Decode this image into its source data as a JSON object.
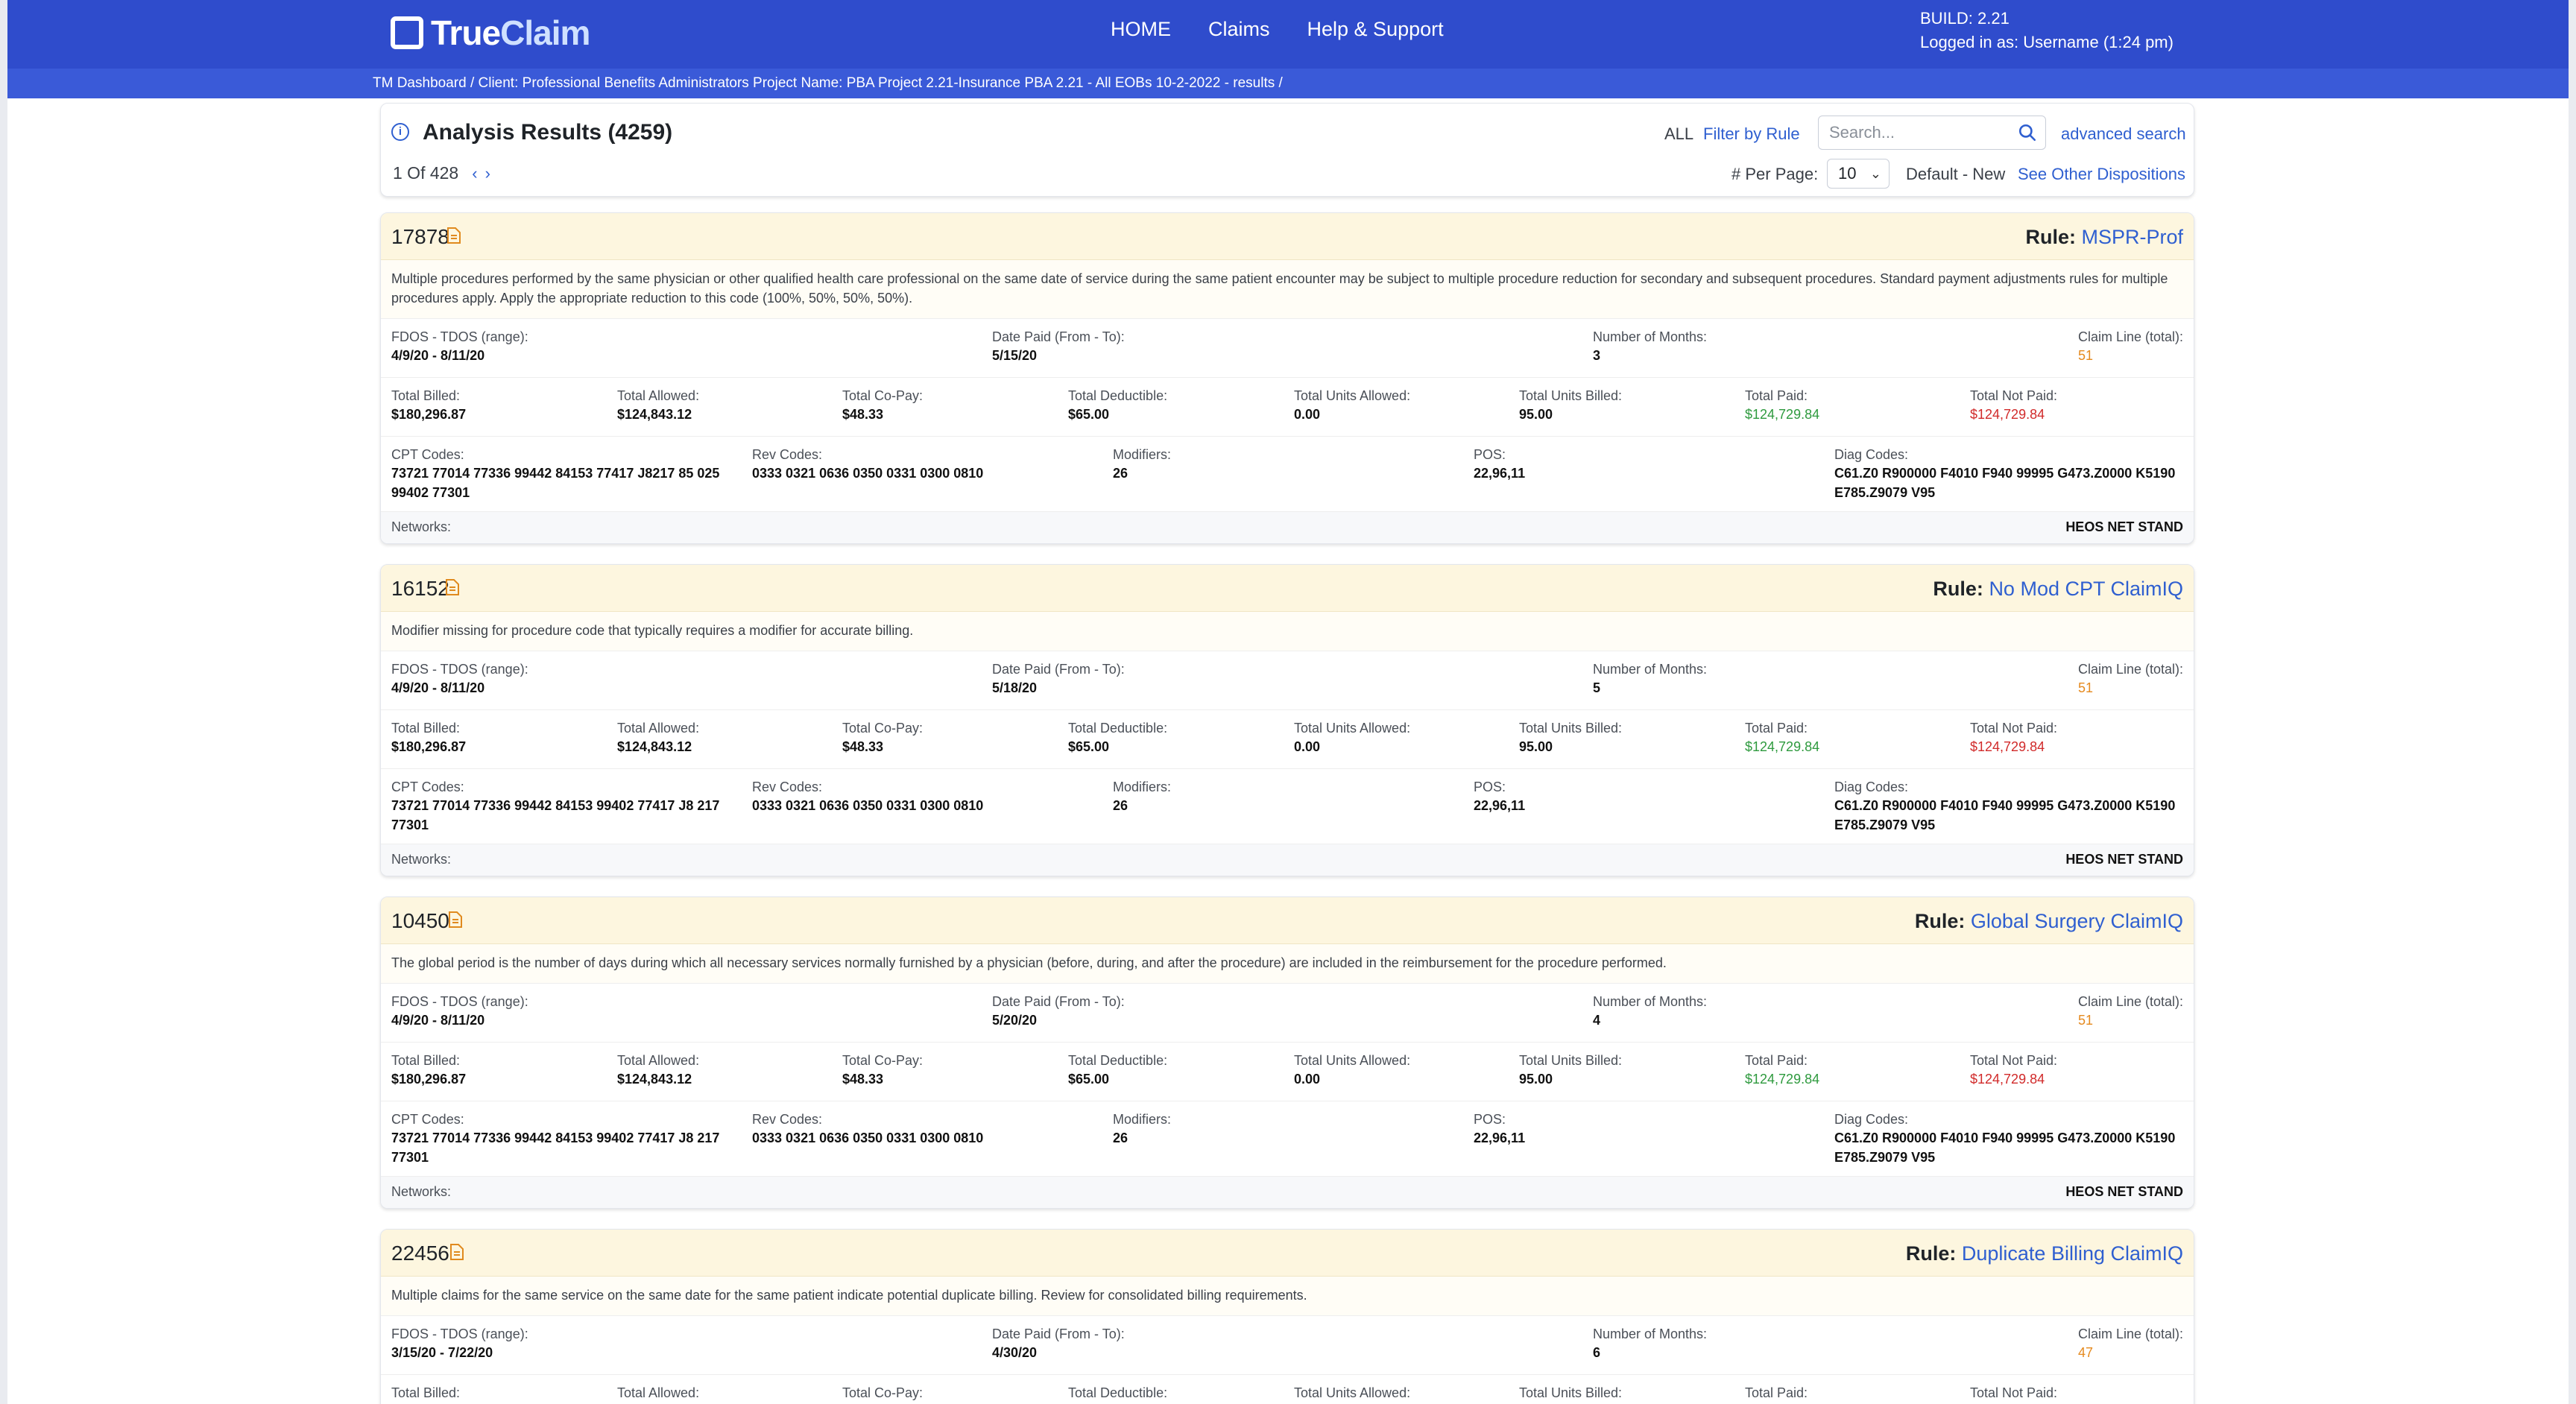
{
  "header": {
    "logo_true": "True",
    "logo_claim": "Claim",
    "nav": [
      "HOME",
      "Claims",
      "Help & Support"
    ],
    "build": "BUILD: 2.21",
    "login": "Logged in as: Username (1:24 pm)"
  },
  "breadcrumb": {
    "dashboard": "TM Dashboard",
    "rest": " / Client: Professional Benefits Administrators Project Name: PBA Project 2.21-Insurance PBA 2.21 - All EOBs 10-2-2022 - results /"
  },
  "results": {
    "title": "Analysis Results (4259)",
    "page": "1 Of 428",
    "all_label": "ALL",
    "filter_label": "Filter by Rule",
    "search_placeholder": "Search...",
    "advanced_label": "advanced search",
    "per_page_label": "# Per Page:",
    "per_page_value": "10",
    "disposition": "Default - New",
    "other_dispositions": "See Other Dispositions"
  },
  "labels": {
    "fdos": "FDOS - TDOS (range):",
    "date_paid": "Date Paid (From - To):",
    "months": "Number of Months:",
    "claim_line": "Claim Line (total):",
    "total_billed": "Total Billed:",
    "total_allowed": "Total Allowed:",
    "total_copay": "Total Co-Pay:",
    "total_deductible": "Total Deductible:",
    "units_allowed": "Total Units Allowed:",
    "units_billed": "Total Units Billed:",
    "total_paid": "Total Paid:",
    "total_not_paid": "Total Not Paid:",
    "cpt": "CPT Codes:",
    "rev": "Rev Codes:",
    "modifiers": "Modifiers:",
    "pos": "POS:",
    "diag": "Diag Codes:",
    "networks": "Networks:",
    "rule_prefix": "Rule: "
  },
  "cards": [
    {
      "id": "17878",
      "rule": "MSPR-Prof",
      "description": "Multiple procedures performed by the same physician or other qualified health care professional on the same date of service during the same patient encounter may be subject to multiple procedure reduction for secondary and subsequent procedures. Standard payment adjustments rules for multiple procedures apply. Apply the appropriate reduction to this code (100%, 50%, 50%, 50%).",
      "fdos": "4/9/20 - 8/11/20",
      "date_paid": "5/15/20",
      "months": "3",
      "claim_line": "51",
      "total_billed": "$180,296.87",
      "total_allowed": "$124,843.12",
      "total_copay": "$48.33",
      "total_deductible": "$65.00",
      "units_allowed": "0.00",
      "units_billed": "95.00",
      "total_paid": "$124,729.84",
      "total_not_paid": "$124,729.84",
      "cpt": "73721 77014 77336 99442 84153 77417 J8217 85 025 99402 77301",
      "rev": "0333 0321 0636 0350 0331 0300 0810",
      "modifiers": "26",
      "pos": "22,96,11",
      "diag": "C61.Z0 R900000 F4010 F940 99995 G473.Z0000 K5190 E785.Z9079 V95",
      "networks": "HEOS NET STAND"
    },
    {
      "id": "16152",
      "rule": "No Mod CPT ClaimIQ",
      "description": "Modifier missing for procedure code that typically requires a modifier for accurate billing.",
      "fdos": "4/9/20 - 8/11/20",
      "date_paid": "5/18/20",
      "months": "5",
      "claim_line": "51",
      "total_billed": "$180,296.87",
      "total_allowed": "$124,843.12",
      "total_copay": "$48.33",
      "total_deductible": "$65.00",
      "units_allowed": "0.00",
      "units_billed": "95.00",
      "total_paid": "$124,729.84",
      "total_not_paid": "$124,729.84",
      "cpt": "73721 77014 77336 99442 84153 99402 77417 J8 217 77301",
      "rev": "0333 0321 0636 0350 0331 0300 0810",
      "modifiers": "26",
      "pos": "22,96,11",
      "diag": "C61.Z0 R900000 F4010 F940 99995 G473.Z0000 K5190 E785.Z9079 V95",
      "networks": "HEOS NET STAND"
    },
    {
      "id": "10450",
      "rule": "Global Surgery ClaimIQ",
      "description": "The global period is the number of days during which all necessary services normally furnished by a physician (before, during, and after the procedure) are included in the reimbursement for the procedure performed.",
      "fdos": "4/9/20 - 8/11/20",
      "date_paid": "5/20/20",
      "months": "4",
      "claim_line": "51",
      "total_billed": "$180,296.87",
      "total_allowed": "$124,843.12",
      "total_copay": "$48.33",
      "total_deductible": "$65.00",
      "units_allowed": "0.00",
      "units_billed": "95.00",
      "total_paid": "$124,729.84",
      "total_not_paid": "$124,729.84",
      "cpt": "73721 77014 77336 99442 84153 99402 77417 J8 217 77301",
      "rev": "0333 0321 0636 0350 0331 0300 0810",
      "modifiers": "26",
      "pos": "22,96,11",
      "diag": "C61.Z0 R900000 F4010 F940 99995 G473.Z0000 K5190 E785.Z9079 V95",
      "networks": "HEOS NET STAND"
    },
    {
      "id": "22456",
      "rule": "Duplicate Billing ClaimIQ",
      "description": "Multiple claims for the same service on the same date for the same patient indicate potential duplicate billing. Review for consolidated billing requirements.",
      "fdos": "3/15/20 - 7/22/20",
      "date_paid": "4/30/20",
      "months": "6",
      "claim_line": "47"
    }
  ]
}
